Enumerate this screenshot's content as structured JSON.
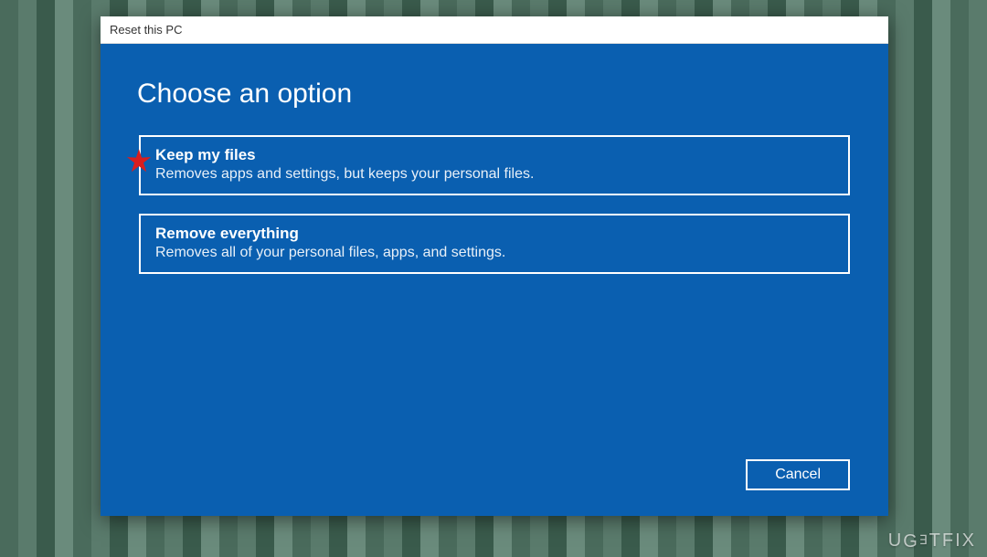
{
  "window": {
    "title": "Reset this PC"
  },
  "heading": "Choose an option",
  "options": [
    {
      "title": "Keep my files",
      "description": "Removes apps and settings, but keeps your personal files."
    },
    {
      "title": "Remove everything",
      "description": "Removes all of your personal files, apps, and settings."
    }
  ],
  "buttons": {
    "cancel": "Cancel"
  },
  "watermark": "UGETFIX",
  "colors": {
    "dialog_bg": "#0a5fb0",
    "star": "#d81e1e"
  }
}
